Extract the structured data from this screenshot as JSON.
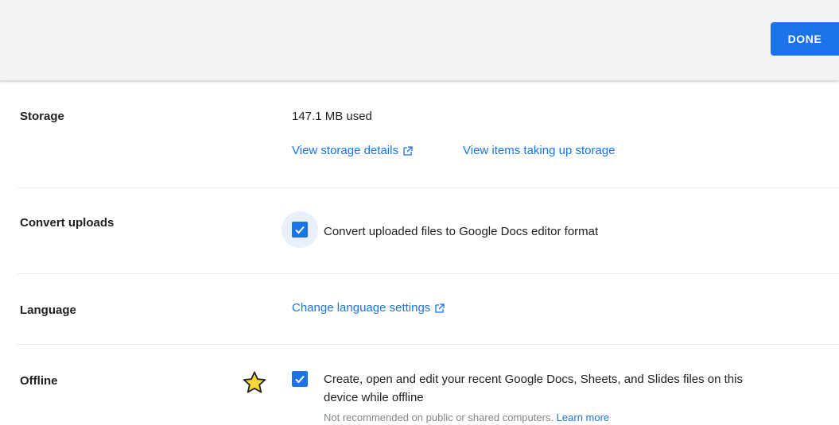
{
  "toolbar": {
    "done_label": "DONE"
  },
  "storage": {
    "label": "Storage",
    "used": "147.1 MB used",
    "view_details": "View storage details",
    "view_items": "View items taking up storage"
  },
  "convert": {
    "label": "Convert uploads",
    "checkbox_text": "Convert uploaded files to Google Docs editor format",
    "checked": true
  },
  "language": {
    "label": "Language",
    "change_link": "Change language settings"
  },
  "offline": {
    "label": "Offline",
    "line1": "Create, open and edit your recent Google Docs, Sheets, and Slides files on this",
    "line2": "device while offline",
    "note": "Not recommended on public or shared computers.",
    "learn_more": "Learn more",
    "checked": true
  },
  "icons": {
    "external": "external-link-icon",
    "check": "check-icon",
    "star": "star-icon"
  },
  "colors": {
    "accent": "#1a73e8",
    "star_fill": "#fdd835",
    "topbar_bg": "#f1f3f4"
  }
}
